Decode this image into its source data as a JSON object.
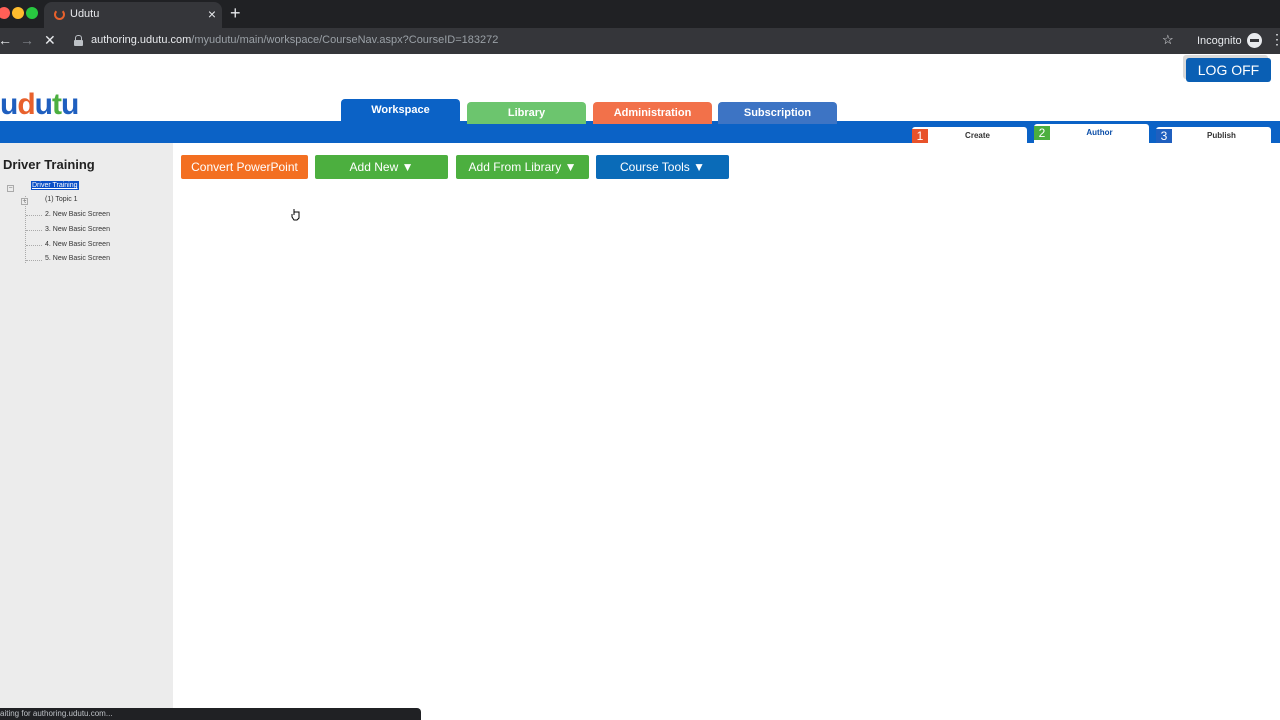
{
  "browser": {
    "tab_title": "Udutu",
    "tab_close": "×",
    "new_tab": "+",
    "back": "←",
    "forward": "→",
    "reload": "✕",
    "url_host": "authoring.udutu.com",
    "url_path": "/myudutu/main/workspace/CourseNav.aspx?CourseID=183272",
    "star": "☆",
    "profile_label": "Incognito",
    "menu": "⋮",
    "status": "aiting for authoring.udutu.com..."
  },
  "header": {
    "logo_letters": [
      "u",
      "d",
      "u",
      "t",
      "u"
    ],
    "logo_colors": [
      "#1f5fbf",
      "#e8612c",
      "#1f5fbf",
      "#4caf3f",
      "#1f5fbf"
    ],
    "logout_label": "LOG OFF"
  },
  "main_tabs": [
    {
      "label": "Workspace",
      "color": "#0b62c6",
      "active": true
    },
    {
      "label": "Library",
      "color": "#6cc56e",
      "active": false
    },
    {
      "label": "Administration",
      "color": "#f2714a",
      "active": false
    },
    {
      "label": "Subscription",
      "color": "#3d74c4",
      "active": false
    }
  ],
  "steps": [
    {
      "number": "1",
      "label": "Create",
      "color": "#e8522a"
    },
    {
      "number": "2",
      "label": "Author",
      "color": "#4caf3f"
    },
    {
      "number": "3",
      "label": "Publish",
      "color": "#1f5fbf"
    }
  ],
  "sidebar": {
    "course_title": "Driver Training",
    "tree_root": "Driver Training",
    "items": [
      {
        "label": "(1) Topic 1"
      },
      {
        "label": "2. New Basic Screen"
      },
      {
        "label": "3. New Basic Screen"
      },
      {
        "label": "4. New Basic Screen"
      },
      {
        "label": "5. New Basic Screen"
      }
    ]
  },
  "actions": [
    {
      "label": "Convert PowerPoint",
      "color": "#f36f21"
    },
    {
      "label": "Add New ▼",
      "color": "#4caf3f"
    },
    {
      "label": "Add From Library ▼",
      "color": "#4caf3f"
    },
    {
      "label": "Course Tools ▼",
      "color": "#0a6bb8"
    }
  ]
}
